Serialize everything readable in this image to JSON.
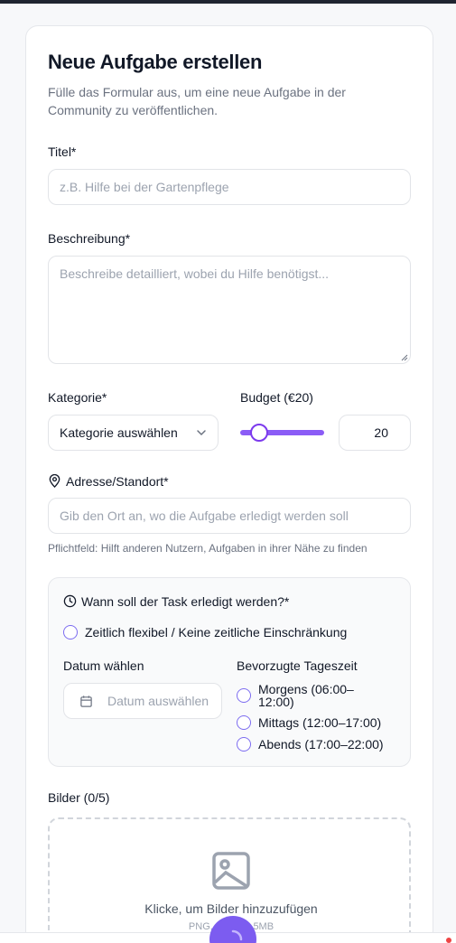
{
  "form": {
    "title": "Neue Aufgabe erstellen",
    "subtitle": "Fülle das Formular aus, um eine neue Aufgabe in der Community zu veröffentlichen.",
    "title_field": {
      "label": "Titel*",
      "placeholder": "z.B. Hilfe bei der Gartenpflege"
    },
    "description": {
      "label": "Beschreibung*",
      "placeholder": "Beschreibe detailliert, wobei du Hilfe benötigst..."
    },
    "category": {
      "label": "Kategorie*",
      "value": "Kategorie auswählen"
    },
    "budget": {
      "label": "Budget (€20)",
      "value": "20",
      "slider_fraction": 0.2
    },
    "address": {
      "label": "Adresse/Standort*",
      "placeholder": "Gib den Ort an, wo die Aufgabe erledigt werden soll",
      "hint": "Pflichtfeld: Hilft anderen Nutzern, Aufgaben in ihrer Nähe zu finden"
    },
    "schedule": {
      "heading": "Wann soll der Task erledigt werden?*",
      "flexible": "Zeitlich flexibel / Keine zeitliche Einschränkung",
      "date_label": "Datum wählen",
      "date_placeholder": "Datum auswählen",
      "time_label": "Bevorzugte Tageszeit",
      "times": [
        "Morgens (06:00–12:00)",
        "Mittags (12:00–17:00)",
        "Abends (17:00–22:00)"
      ]
    },
    "images": {
      "label": "Bilder (0/5)",
      "cta": "Klicke, um Bilder hinzuzufügen",
      "note": "PNG, JPG bis 5MB"
    }
  },
  "colors": {
    "accent": "#7c5cf0",
    "slider": "#8b5cf6"
  }
}
